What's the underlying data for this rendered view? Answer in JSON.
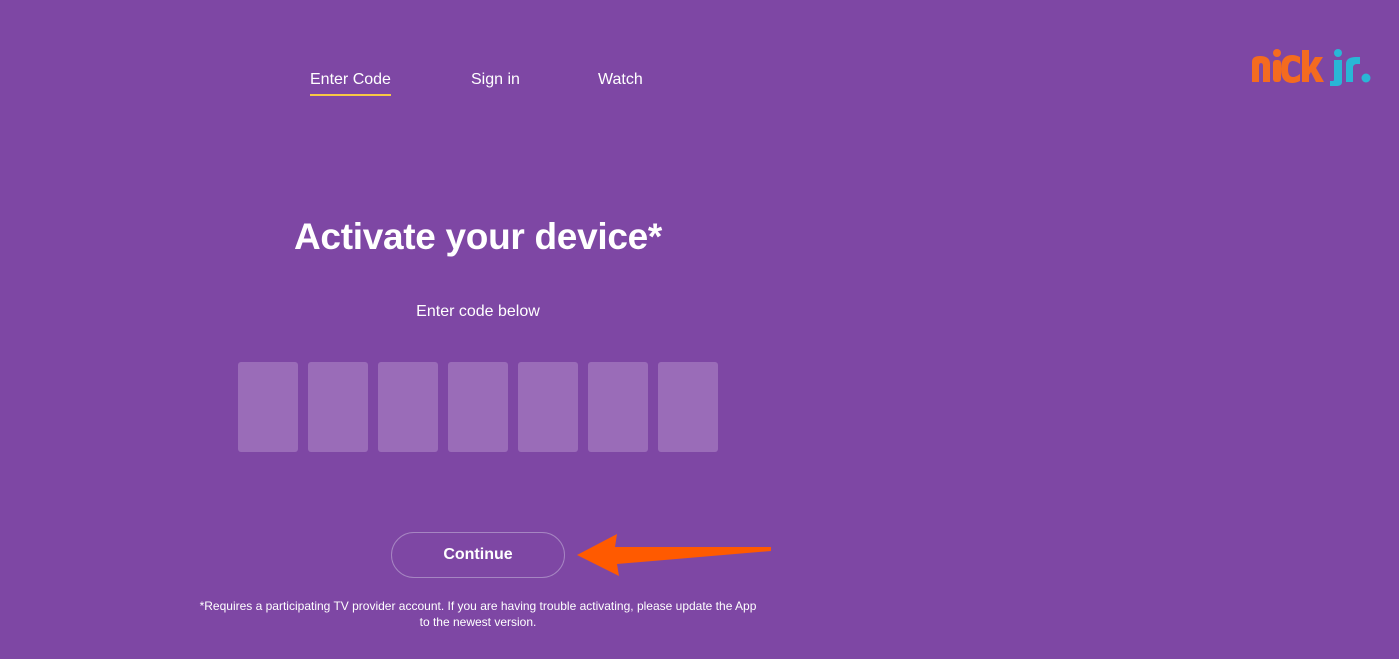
{
  "nav": {
    "items": [
      {
        "label": "Enter Code",
        "active": true
      },
      {
        "label": "Sign in",
        "active": false
      },
      {
        "label": "Watch",
        "active": false
      }
    ],
    "active_underline_color": "#f7c843"
  },
  "logo": {
    "text": "nick jr.",
    "colors": {
      "nick": "#f46b1f",
      "jr": "#29b6d6"
    }
  },
  "main": {
    "title": "Activate your device*",
    "subtitle": "Enter code below",
    "code_boxes": [
      "",
      "",
      "",
      "",
      "",
      "",
      ""
    ],
    "continue_label": "Continue"
  },
  "annotation": {
    "icon": "arrow-left-icon",
    "color": "#ff5a00"
  },
  "footnote": {
    "line1": "*Requires a participating TV provider account. If you are having trouble activating, please update the App",
    "line2": "to the newest version."
  },
  "theme": {
    "background": "#7e47a4",
    "box_fill": "#9a6cb8"
  }
}
